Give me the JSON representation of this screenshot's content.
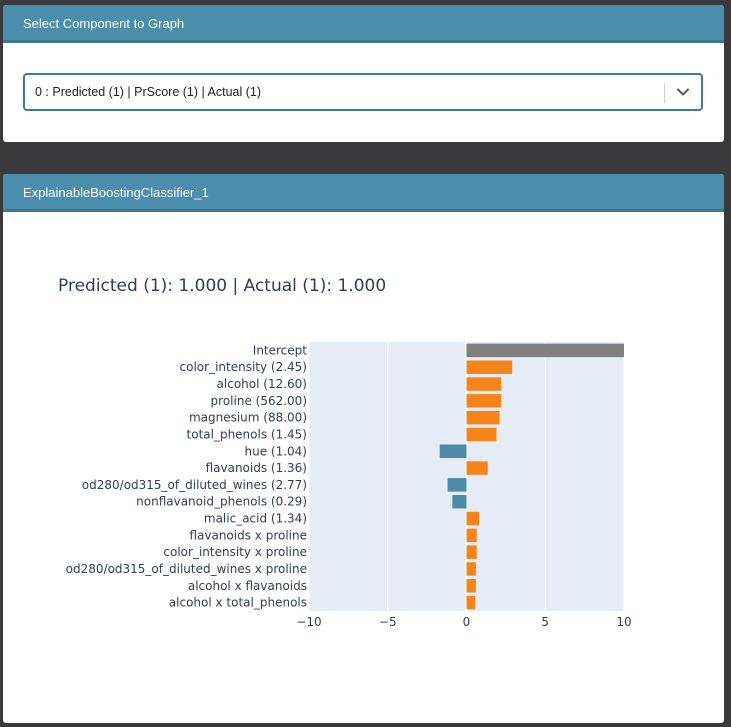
{
  "selector_panel": {
    "title": "Select Component to Graph",
    "selected_value": "0 : Predicted (1) | PrScore (1) | Actual (1)"
  },
  "chart_panel": {
    "title": "ExplainableBoostingClassifier_1"
  },
  "colors": {
    "header": "#4a8eab",
    "positive": "#f58518",
    "negative": "#4c8aa7",
    "intercept": "#7f7f7f",
    "plot_bg": "#e5ecf6"
  },
  "chart_data": {
    "type": "bar",
    "orientation": "horizontal",
    "title": "Predicted (1): 1.000 | Actual (1): 1.000",
    "categories": [
      "Intercept",
      "color_intensity (2.45)",
      "alcohol (12.60)",
      "proline (562.00)",
      "magnesium (88.00)",
      "total_phenols (1.45)",
      "hue (1.04)",
      "flavanoids (1.36)",
      "od280/od315_of_diluted_wines (2.77)",
      "nonflavanoid_phenols (0.29)",
      "malic_acid (1.34)",
      "flavanoids x proline",
      "color_intensity x proline",
      "od280/od315_of_diluted_wines x proline",
      "alcohol x flavanoids",
      "alcohol x total_phenols"
    ],
    "values": [
      10.5,
      2.9,
      2.2,
      2.2,
      2.1,
      1.9,
      -1.7,
      1.35,
      -1.2,
      -0.9,
      0.8,
      0.65,
      0.65,
      0.6,
      0.6,
      0.55
    ],
    "xlim": [
      -10,
      10
    ],
    "xticks": [
      -10,
      -5,
      0,
      5,
      10
    ],
    "xtick_labels": [
      "−10",
      "−5",
      "0",
      "5",
      "10"
    ],
    "grid": true
  }
}
